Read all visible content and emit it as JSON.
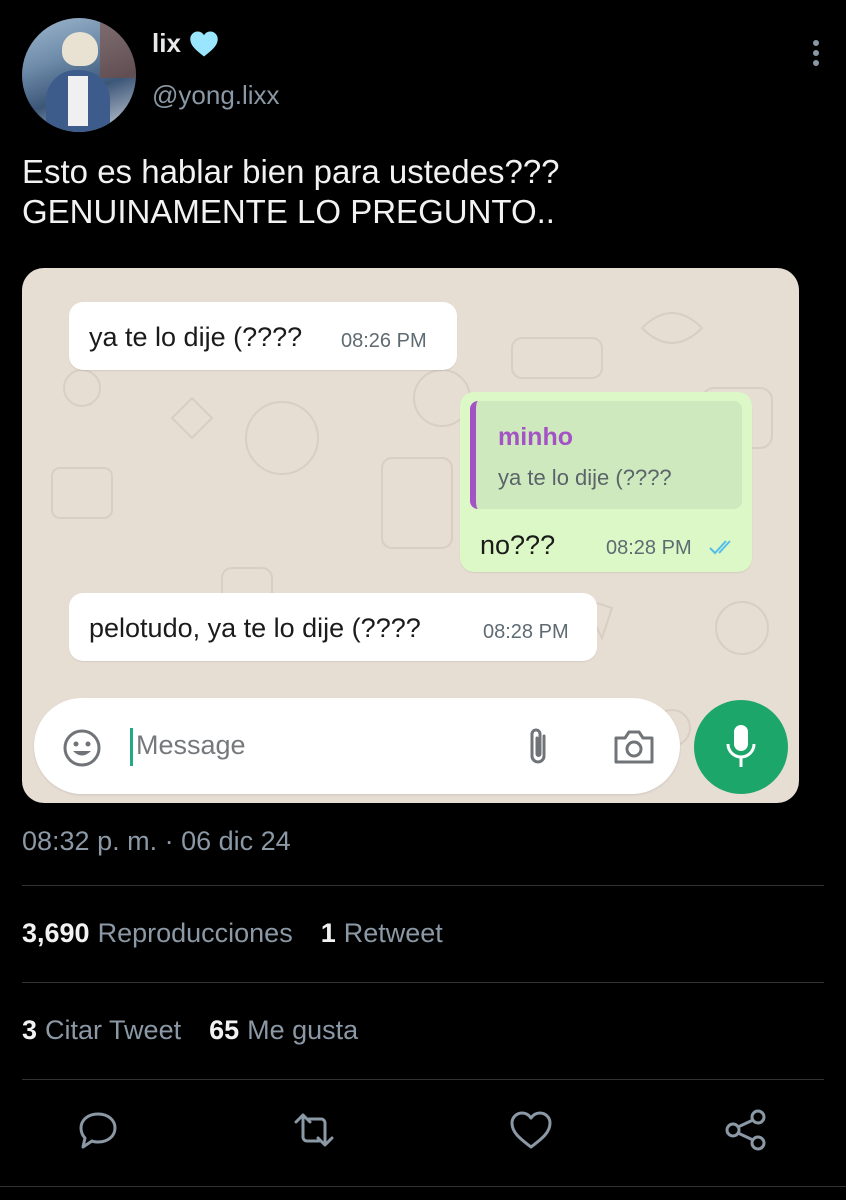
{
  "author": {
    "name": "lix",
    "handle": "@yong.lixx",
    "badge_icon": "light-blue-heart-icon",
    "badge_color": "#9be6ff"
  },
  "tweet": {
    "line1": "Esto es hablar bien para ustedes???",
    "line2": "GENUINAMENTE LO PREGUNTO.."
  },
  "chat": {
    "messages": [
      {
        "direction": "incoming",
        "text": "ya te lo dije (????",
        "time": "08:26 PM"
      },
      {
        "direction": "outgoing",
        "reply_to_name": "minho",
        "reply_to_text": "ya te lo dije (????",
        "text": "no???",
        "time": "08:28 PM",
        "status": "read-ticks-icon"
      },
      {
        "direction": "incoming",
        "text": "pelotudo, ya te lo dije (????",
        "time": "08:28 PM"
      }
    ],
    "input": {
      "placeholder": "Message"
    },
    "colors": {
      "outgoing": "#dcf8c6",
      "incoming": "#ffffff",
      "quote_bar": "#a453c5",
      "mic": "#1da669",
      "ticks": "#53bdeb"
    }
  },
  "meta": {
    "timestamp": "08:32 p. m. · 06 dic 24"
  },
  "stats": {
    "views_count": "3,690",
    "views_label": "Reproducciones",
    "retweets_count": "1",
    "retweets_label": "Retweet",
    "quotes_count": "3",
    "quotes_label": "Citar Tweet",
    "likes_count": "65",
    "likes_label": "Me gusta"
  },
  "actions": [
    "reply-icon",
    "retweet-icon",
    "like-icon",
    "share-icon"
  ]
}
